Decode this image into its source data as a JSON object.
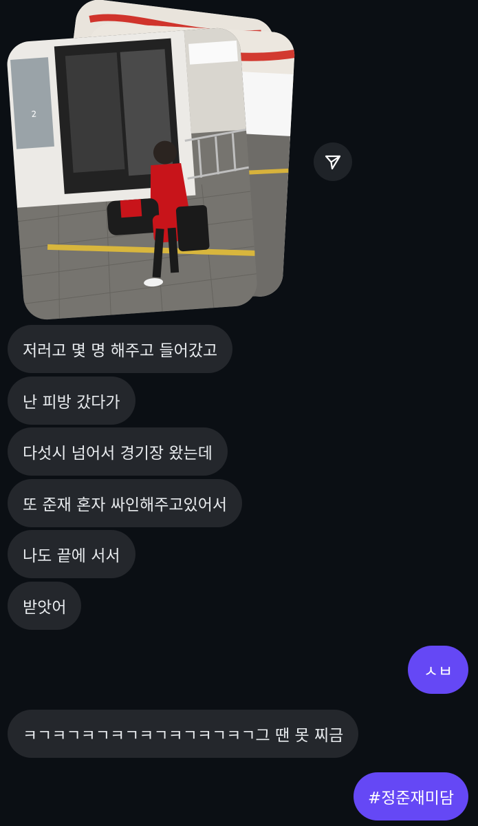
{
  "attachment": {
    "media_type": "photo-stack",
    "share_icon": "send-arrow-icon"
  },
  "messages": [
    {
      "side": "in",
      "text": "저러고 몇 명 해주고 들어갔고"
    },
    {
      "side": "in",
      "text": "난 피방 갔다가"
    },
    {
      "side": "in",
      "text": "다섯시 넘어서 경기장 왔는데"
    },
    {
      "side": "in",
      "text": "또 준재 혼자 싸인해주고있어서"
    },
    {
      "side": "in",
      "text": "나도 끝에 서서"
    },
    {
      "side": "in",
      "text": "받앗어"
    },
    {
      "side": "out",
      "text": "ㅅㅂ"
    },
    {
      "side": "in",
      "text": "ㅋㄱㅋㄱㅋㄱㅋㄱㅋㄱㅋㄱㅋㄱㅋㄱ그 땐 못 찌금"
    },
    {
      "side": "out",
      "text": "#정준재미담"
    }
  ],
  "colors": {
    "background": "#0b0f14",
    "incoming_bubble": "#24272c",
    "outgoing_bubble": "#6548f5",
    "text": "#e9ecef"
  }
}
